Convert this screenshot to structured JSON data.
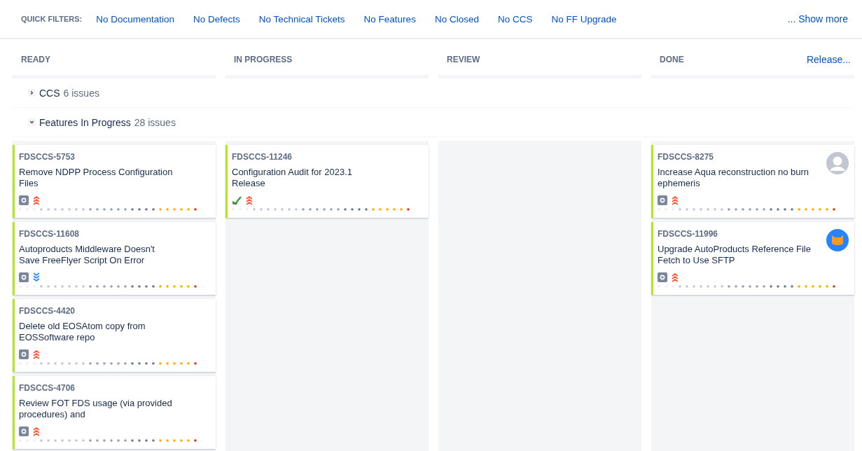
{
  "quick_filters": {
    "label": "QUICK FILTERS:",
    "items": [
      "No Documentation",
      "No Defects",
      "No Technical Tickets",
      "No Features",
      "No Closed",
      "No CCS",
      "No FF Upgrade"
    ],
    "show_more": "... Show more"
  },
  "columns": [
    {
      "title": "READY"
    },
    {
      "title": "IN PROGRESS"
    },
    {
      "title": "REVIEW"
    },
    {
      "title": "DONE",
      "action": "Release..."
    }
  ],
  "swimlanes": [
    {
      "name": "CCS",
      "count": "6 issues",
      "expanded": false
    },
    {
      "name": "Features In Progress",
      "count": "28 issues",
      "expanded": true,
      "columns": [
        [
          {
            "key": "FDSCCS-5753",
            "summary": "Remove NDPP Process Configuration Files",
            "kind": "task",
            "high_priority": true
          },
          {
            "key": "FDSCCS-11608",
            "summary": "Autoproducts Middleware Doesn't Save FreeFlyer Script On Error",
            "kind": "task",
            "high_priority": false
          },
          {
            "key": "FDSCCS-4420",
            "summary": "Delete old EOSAtom copy from EOSSoftware repo",
            "kind": "task",
            "high_priority": true
          },
          {
            "key": "FDSCCS-4706",
            "summary": "Review FOT FDS usage (via provided procedures) and",
            "kind": "task",
            "high_priority": true
          }
        ],
        [
          {
            "key": "FDSCCS-11246",
            "summary": "Configuration Audit for 2023.1 Release",
            "kind": "check",
            "high_priority": true
          }
        ],
        [],
        [
          {
            "key": "FDSCCS-8275",
            "summary": "Increase Aqua reconstruction no burn ephemeris",
            "kind": "task",
            "high_priority": true,
            "avatar": {
              "kind": "silhouette"
            }
          },
          {
            "key": "FDSCCS-11996",
            "summary": "Upgrade AutoProducts Reference File Fetch to Use SFTP",
            "kind": "task",
            "high_priority": true,
            "avatar": {
              "kind": "cat"
            }
          }
        ]
      ]
    }
  ]
}
